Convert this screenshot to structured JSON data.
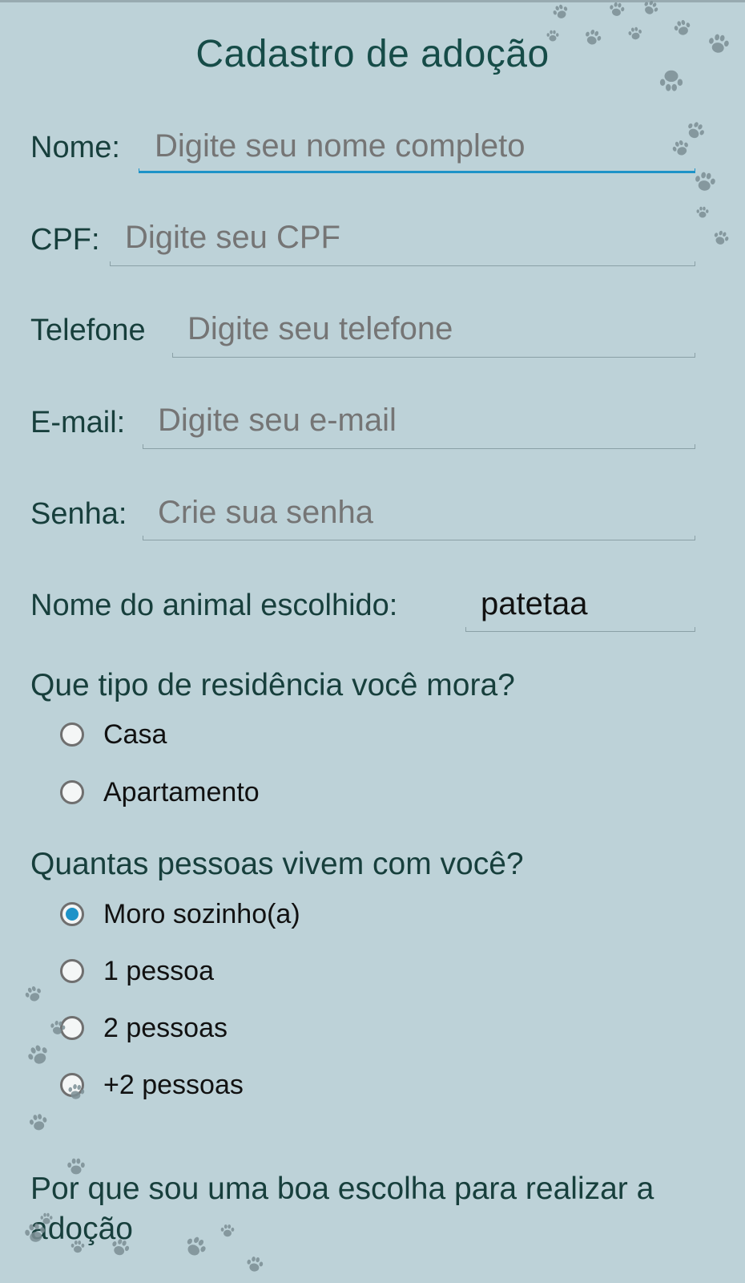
{
  "title": "Cadastro de adoção",
  "fields": [
    {
      "label": "Nome:",
      "placeholder": "Digite seu nome completo",
      "value": ""
    },
    {
      "label": "CPF:",
      "placeholder": "Digite seu CPF",
      "value": ""
    },
    {
      "label": "Telefone",
      "placeholder": "Digite seu telefone",
      "value": ""
    },
    {
      "label": "E-mail:",
      "placeholder": "Digite seu e-mail",
      "value": ""
    },
    {
      "label": "Senha:",
      "placeholder": "Crie sua senha",
      "value": ""
    },
    {
      "label": "Nome do animal escolhido:",
      "placeholder": "",
      "value": "patetaa"
    }
  ],
  "residence": {
    "question": "Que tipo de residência você mora?",
    "options": [
      "Casa",
      "Apartamento"
    ],
    "selected": null
  },
  "people": {
    "question": "Quantas pessoas vivem com você?",
    "options": [
      "Moro sozinho(a)",
      "1 pessoa",
      "2 pessoas",
      "+2 pessoas"
    ],
    "selected": "Moro sozinho(a)"
  },
  "why_question": "Por que sou uma boa escolha para realizar a adoção",
  "colors": {
    "background": "#bdd2d8",
    "accent": "#1e93c8",
    "label_text": "#173f3c",
    "paw_prints": "#7c8f95"
  },
  "decoration_icon": "paw-print-icon"
}
